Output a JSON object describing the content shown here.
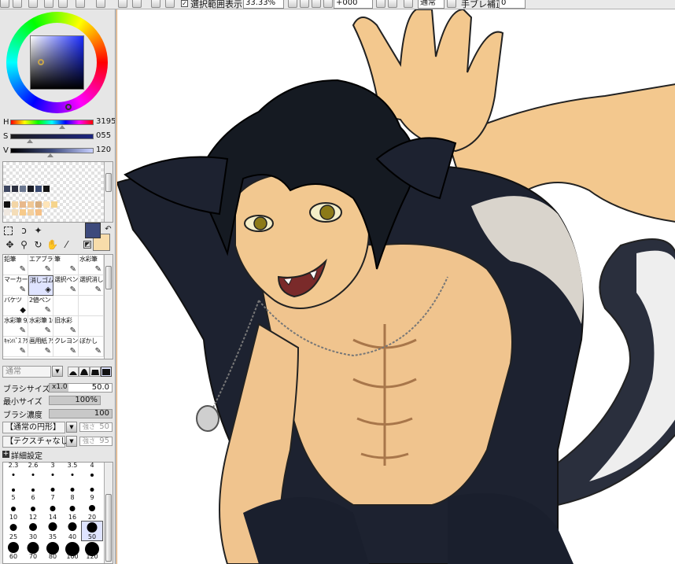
{
  "toolbar": {
    "selection_checkbox_checked": true,
    "selection_label": "選択範囲表示",
    "zoom_value": "33.33%",
    "angle_value": "+000",
    "blend_mode": "通常",
    "stabilizer_label": "手ブレ補正",
    "stabilizer_value": "0"
  },
  "colors": {
    "hue": {
      "label": "H",
      "value": "3195"
    },
    "saturation": {
      "label": "S",
      "value": "055"
    },
    "value": {
      "label": "V",
      "value": "120"
    },
    "main_color": "#3d4a7c",
    "sub_color": "#f8dcaa"
  },
  "swatches": {
    "row1": [
      "#3d4660",
      "#2c3040",
      "#6b7891",
      "#1a1c24",
      "#3a4a70",
      "#151515"
    ],
    "row2": [
      "#101010",
      "#f3d6a6",
      "#e8b98c",
      "#f0c896",
      "#d8ae80",
      "#ffe5b8",
      "#f5d48c"
    ],
    "row3": [
      "#efe8e0",
      "#f4ddb8",
      "#f7ca8a",
      "#f4d09e",
      "#f5c086"
    ]
  },
  "tool_icons": [
    "selection-rect",
    "lasso",
    "magic-wand",
    "move",
    "zoom",
    "rotate",
    "hand",
    "eyedropper"
  ],
  "tools": [
    {
      "label": "鉛筆",
      "icon": "✎"
    },
    {
      "label": "エアブラシ",
      "icon": "✎"
    },
    {
      "label": "筆",
      "icon": "✎"
    },
    {
      "label": "水彩筆",
      "icon": "✎"
    },
    {
      "label": "マーカー",
      "icon": "✎"
    },
    {
      "label": "消しゴム",
      "icon": "◈"
    },
    {
      "label": "選択ペン",
      "icon": "✎"
    },
    {
      "label": "選択消し",
      "icon": "✎"
    },
    {
      "label": "バケツ",
      "icon": "◆"
    },
    {
      "label": "2値ペン",
      "icon": "✎"
    },
    {
      "label": "",
      "icon": ""
    },
    {
      "label": "",
      "icon": ""
    },
    {
      "label": "水彩筆 9版",
      "icon": "✎"
    },
    {
      "label": "水彩筆 10版",
      "icon": "✎"
    },
    {
      "label": "旧水彩",
      "icon": "✎"
    },
    {
      "label": "",
      "icon": ""
    },
    {
      "label": "ｷｬﾝﾊﾞｽ ｱｸﾘﾙ",
      "icon": "✎"
    },
    {
      "label": "画用紙 ｱｸﾘﾙ",
      "icon": "✎"
    },
    {
      "label": "クレヨン",
      "icon": "✎"
    },
    {
      "label": "ぼかし",
      "icon": "✎"
    }
  ],
  "brush": {
    "mode": "通常",
    "size_label": "ブラシサイズ",
    "size_multiplier": "x1.0",
    "size_value": "50.0",
    "min_size_label": "最小サイズ",
    "min_size_value": "100%",
    "density_label": "ブラシ濃度",
    "density_value": "100",
    "shape_label": "【通常の円形】",
    "shape_strength_label": "強さ",
    "shape_strength_value": "50",
    "texture_label": "【テクスチャなし】",
    "texture_strength_label": "強さ",
    "texture_strength_value": "95",
    "advanced_label": "詳細設定"
  },
  "brush_sizes": [
    "2.3",
    "2.6",
    "3",
    "3.5",
    "4",
    "5",
    "6",
    "7",
    "8",
    "9",
    "10",
    "12",
    "14",
    "16",
    "20",
    "25",
    "30",
    "35",
    "40",
    "50",
    "60",
    "70",
    "80",
    "100",
    "120"
  ],
  "brush_size_selected": "50"
}
